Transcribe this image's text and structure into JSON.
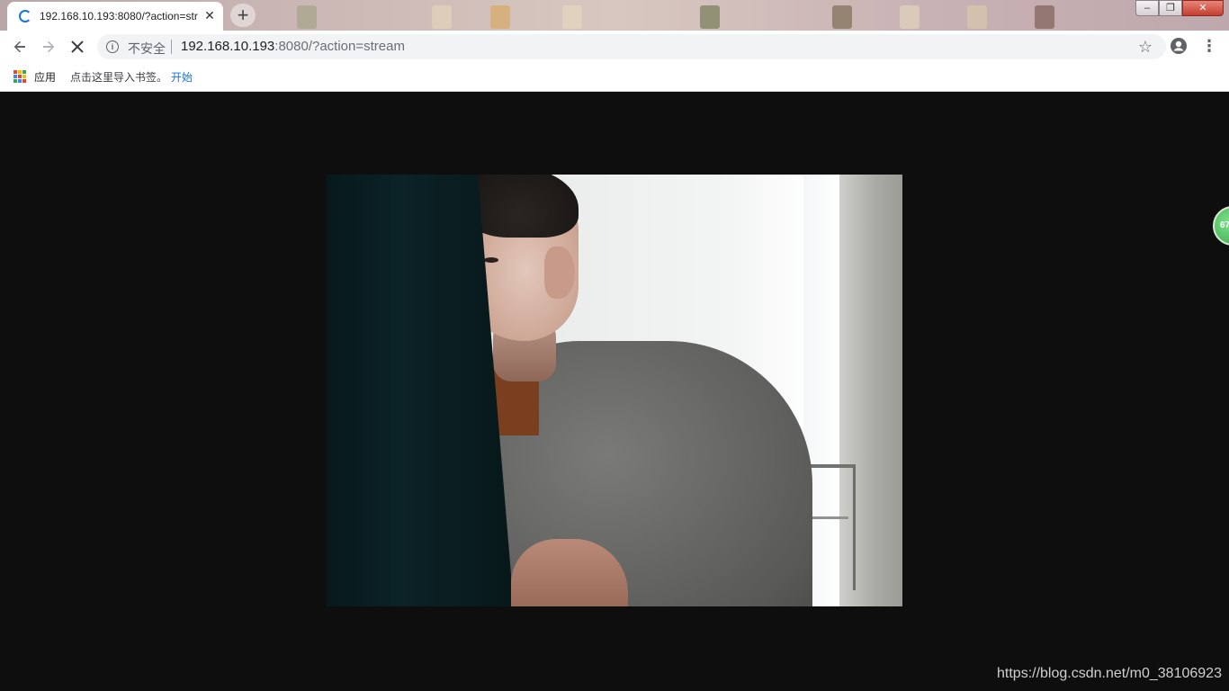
{
  "browser": {
    "tab": {
      "title": "192.168.10.193:8080/?action=stream"
    },
    "window_controls": {
      "minimize": "–",
      "maximize": "❐",
      "close": "✕"
    },
    "toolbar": {
      "security_label": "不安全",
      "url_host": "192.168.10.193",
      "url_rest": ":8080/?action=stream"
    },
    "bookmarks": {
      "apps_label": "应用",
      "hint": "点击这里导入书签。",
      "start_link": "开始"
    }
  },
  "page": {
    "badge_text": "67",
    "watermark": "https://blog.csdn.net/m0_38106923"
  },
  "icons": {
    "tab_loading": "spinner-icon",
    "tab_close": "close-icon",
    "new_tab": "plus-icon",
    "back": "arrow-left-icon",
    "forward": "arrow-right-icon",
    "stop": "stop-icon",
    "info": "info-icon",
    "bookmark": "star-icon",
    "profile": "profile-icon",
    "menu": "more-vert-icon",
    "apps": "apps-grid-icon"
  },
  "colors": {
    "accent": "#1a73e8",
    "page_background": "#0e0e0e",
    "close_button": "#c33f2f"
  }
}
